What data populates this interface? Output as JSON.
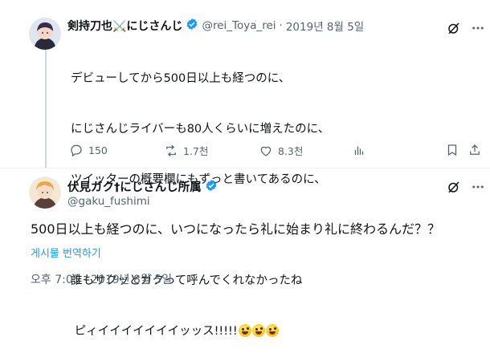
{
  "first_tweet": {
    "author_name": "剣持刀也⚔️にじさんじ",
    "handle": "@rei_Toya_rei",
    "separator": "·",
    "date": "2019년 8월 5일",
    "lines": [
      "デビューしてから500日以上も経つのに、",
      "にじさんじライバーも80人くらいに増えたのに、",
      "ツイッターの概要欄にもずっと書いてあるのに、",
      "",
      "誰もサクッとガクって呼んでくれなかったね",
      " ピィイイイイイイイッッス!!!!!"
    ],
    "emoji": [
      "zany-face",
      "zany-face",
      "zany-face"
    ],
    "actions": {
      "replies": "150",
      "reposts": "1.7천",
      "likes": "8.3천"
    },
    "icons": {
      "grok": "grok-icon",
      "more": "more-icon",
      "reply": "reply-icon",
      "repost": "repost-icon",
      "like": "heart-icon",
      "views": "views-icon",
      "bookmark": "bookmark-icon",
      "share": "share-icon",
      "verified": "verified-badge-icon"
    }
  },
  "second_tweet": {
    "author_name": "伏見ガク†にじさんじ所属",
    "handle": "@gaku_fushimi",
    "text": "500日以上も経つのに、いつになったら礼に始まり礼に終わるんだ？？",
    "translate_link": "게시물 번역하기",
    "timestamp": "오후 7:05 · 2019년 8월 5일"
  },
  "colors": {
    "accent": "#1d9bf0",
    "text": "#0f1419",
    "secondary": "#536471",
    "divider": "#eff3f4"
  }
}
